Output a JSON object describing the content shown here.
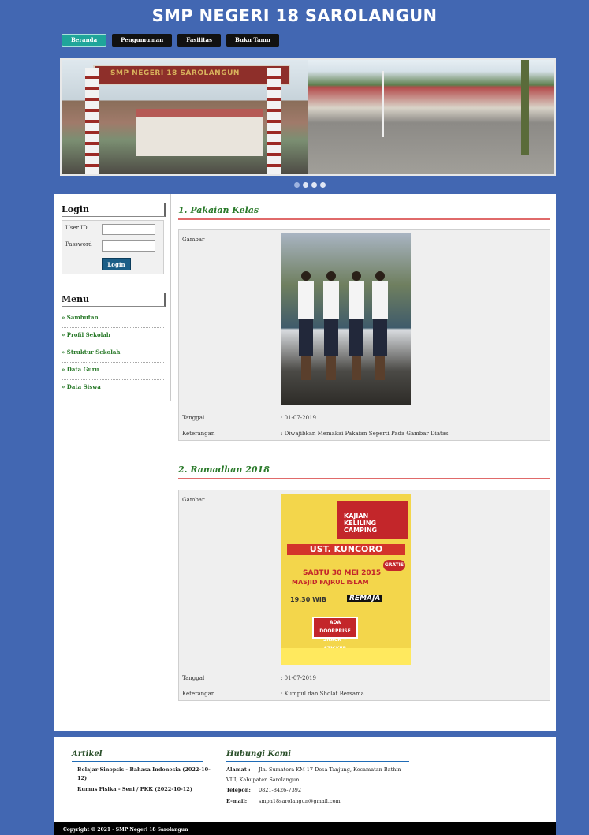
{
  "site": {
    "title": "SMP NEGERI 18 SAROLANGUN"
  },
  "nav": [
    "Beranda",
    "Pengumuman",
    "Fasilitas",
    "Buku Tamu"
  ],
  "banner": {
    "sign_text": "SMP NEGERI 18 SAROLANGUN",
    "slides": 4,
    "active_slide": 1
  },
  "sidebar": {
    "login": {
      "title": "Login",
      "user_label": "User ID",
      "pass_label": "Password",
      "button": "Login"
    },
    "menu": {
      "title": "Menu",
      "items": [
        "» Sambutan",
        "» Profil Sekolah",
        "» Struktur Sekolah",
        "» Data Guru",
        "» Data Siswa"
      ]
    }
  },
  "posts": [
    {
      "title": "1. Pakaian Kelas",
      "image_label": "Gambar",
      "date_label": "Tanggal",
      "date": ": 01-07-2019",
      "desc_label": "Keterangan",
      "desc": ": Diwajibkan Memakai Pakaian Seperti Pada Gambar Diatas"
    },
    {
      "title": "2. Ramadhan 2018",
      "image_label": "Gambar",
      "date_label": "Tanggal",
      "date": ": 01-07-2019",
      "desc_label": "Keterangan",
      "desc": ": Kumpul dan Sholat Bersama"
    }
  ],
  "poster": {
    "l1": "KAJIAN",
    "l2": "KELILING",
    "l3": "CAMPING",
    "l4": "UST. KUNCORO",
    "l5": "SABTU 30 MEI 2015",
    "l6": "MASJID FAJRUL ISLAM",
    "l7": "19.30 WIB",
    "l8": "REMAJA",
    "l9": "ADA DOORPRISE",
    "l10": "SNACK + STICKER",
    "l11": "GRATIS"
  },
  "footer": {
    "artikel": {
      "title": "Artikel",
      "items": [
        "Belajar Sinopsis - Bahasa Indonesia (2022-10-",
        "12)",
        "Rumus Fisika - Seni / PKK (2022-10-12)"
      ]
    },
    "kontak": {
      "title": "Hubungi Kami",
      "alamat_label": "Alamat :",
      "alamat_1": "Jln. Sumatera KM 17 Desa Tanjung, Kecamatan Bathin",
      "alamat_2": "VIII, Kabupaten Sarolangun",
      "telepon_label": "Telepon:",
      "telepon": "0821-8426-7392",
      "email_label": "E-mail:",
      "email": "smpn18sarolangun@gmail.com"
    },
    "copyright": "Copyright © 2021 - SMP Negeri 18 Sarolangun"
  }
}
